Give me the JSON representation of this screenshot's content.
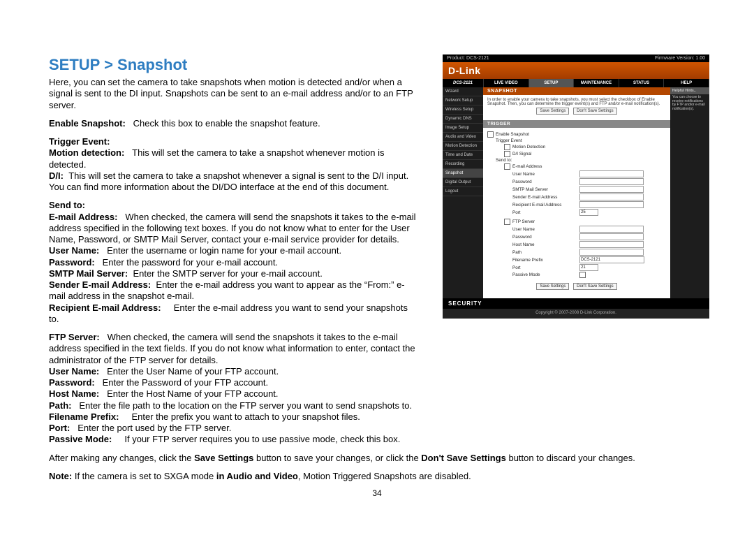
{
  "page_number": "34",
  "title": "SETUP > Snapshot",
  "intro": "Here, you can set the camera to take snapshots when motion is detected and/or when a signal is sent to the DI input. Snapshots can be sent to an e-mail address and/or to an FTP server.",
  "enable_snapshot_label": "Enable Snapshot:",
  "enable_snapshot_text": "Check this box to enable the snapshot feature.",
  "trigger_event_label": "Trigger Event:",
  "motion_detection_label": "Motion detection:",
  "motion_detection_text": "This will set the camera to take a snapshot whenever motion is detected.",
  "di_label": "D/I:",
  "di_text": "This will set the camera to take a snapshot whenever a signal is sent to the D/I input. You can find more information about the DI/DO interface at the end of this document.",
  "send_to_label": "Send to:",
  "email_addr_label": "E-mail Address:",
  "email_addr_text": "When checked, the camera will send the snapshots it takes to the e-mail address specified in the following text boxes. If you do not know what to enter for the User Name, Password, or SMTP Mail Server, contact your e-mail service provider for details.",
  "user_name_label": "User Name:",
  "user_name_text": "Enter the username or login name for your e-mail account.",
  "password_label": "Password:",
  "password_text": "Enter the password for your e-mail account.",
  "smtp_label": "SMTP Mail Server:",
  "smtp_text": "Enter the SMTP server for your e-mail account.",
  "sender_label": "Sender E-mail Address:",
  "sender_text": "Enter the e-mail address you want to appear as the “From:” e-mail address in the snapshot e-mail.",
  "recipient_label": "Recipient E-mail Address:",
  "recipient_text": "Enter the e-mail address you want to send your snapshots to.",
  "ftp_server_label": "FTP Server:",
  "ftp_server_text": "When checked, the camera will send the snapshots it takes to the e-mail address specified in the text fields. If you do not know what information to enter, contact the administrator of the FTP server for details.",
  "ftp_user_label": "User Name:",
  "ftp_user_text": "Enter the User Name of your FTP account.",
  "ftp_pass_label": "Password:",
  "ftp_pass_text": "Enter the Password of your FTP account.",
  "ftp_host_label": "Host Name:",
  "ftp_host_text": "Enter the Host Name of your FTP account.",
  "ftp_path_label": "Path:",
  "ftp_path_text": "Enter the file path to the location on the FTP server you want to send snapshots to.",
  "ftp_prefix_label": "Filename Prefix:",
  "ftp_prefix_text": "Enter the prefix you want to attach to your snapshot files.",
  "ftp_port_label": "Port:",
  "ftp_port_text": "Enter the port used by the FTP server.",
  "passive_label": "Passive Mode:",
  "passive_text": "If your FTP server requires you to use passive mode, check this box.",
  "after_text_pre": "After making any changes, click the ",
  "after_text_save": "Save Settings",
  "after_text_mid": " button to save your changes, or click the ",
  "after_text_dont": "Don't Save Settings",
  "after_text_post": " button to discard your changes.",
  "note_pre": "Note:",
  "note_mid1": " If the camera is set to SXGA mode ",
  "note_bold": "in Audio and Video",
  "note_post": ", Motion Triggered Snapshots are disabled.",
  "shot": {
    "product": "Product: DCS-2121",
    "fw": "Firmware Version: 1.00",
    "logo": "D-Link",
    "nav": {
      "model": "DCS-2121",
      "live": "LIVE VIDEO",
      "setup": "SETUP",
      "maint": "MAINTENANCE",
      "status": "STATUS",
      "help": "HELP"
    },
    "sidebar": [
      "Wizard",
      "Network Setup",
      "Wireless Setup",
      "Dynamic DNS",
      "Image Setup",
      "Audio and Video",
      "Motion Detection",
      "Time and Date",
      "Recording",
      "Snapshot",
      "Digital Output",
      "Logout"
    ],
    "hints_hd": "Helpful Hints..",
    "hints_body": "You can choose to receive notifications by FTP and/or e-mail notification(s).",
    "sec_title": "SNAPSHOT",
    "sec_text": "In order to enable your camera to take snapshots, you must select the checkbox of Enable Snapshot. Then, you can determine the trigger event(s) and FTP and/or e-mail notification(s).",
    "save": "Save Settings",
    "dont": "Don't Save Settings",
    "trigger_hd": "TRIGGER",
    "f_enable": "Enable Snapshot",
    "f_trig": "Trigger Event",
    "f_motion": "Motion Detection",
    "f_di": "D/I Signal",
    "f_sendto": "Send to:",
    "f_email": "E-mail Address",
    "f_user": "User Name",
    "f_pass": "Password",
    "f_smtp": "SMTP Mail Server",
    "f_sender": "Sender E-mail Address",
    "f_recip": "Recipient E-mail Address",
    "f_port": "Port",
    "f_port_val": "25",
    "f_ftp": "FTP Server",
    "f_host": "Host Name",
    "f_path": "Path",
    "f_prefix": "Filename Prefix",
    "f_prefix_val": "DCS-2121",
    "f_fport": "Port",
    "f_fport_val": "21",
    "f_passive": "Passive Mode",
    "security": "SECURITY",
    "copyright": "Copyright © 2007-2008 D-Link Corporation."
  }
}
